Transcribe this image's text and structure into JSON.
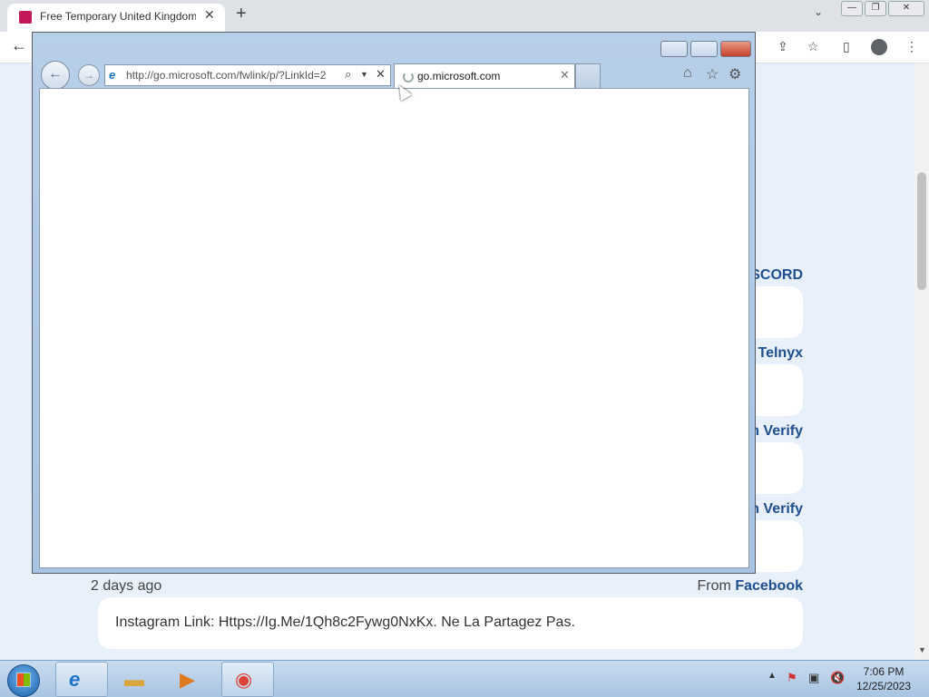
{
  "chrome": {
    "tab_title": "Free Temporary United Kingdom",
    "new_tab_symbol": "+"
  },
  "page": {
    "sources": [
      {
        "label": "SCORD"
      },
      {
        "label": "Telnyx"
      },
      {
        "label": "n Verify"
      },
      {
        "label": "n Verify"
      }
    ],
    "last_message": {
      "time_ago": "2 days ago",
      "from_prefix": "From",
      "from_source": "Facebook",
      "text": "Instagram Link: Https://Ig.Me/1Qh8c2Fywg0NxKx. Ne La Partagez Pas."
    }
  },
  "ie": {
    "address": "http://go.microsoft.com/fwlink/p/?LinkId=2",
    "tab_title": "go.microsoft.com"
  },
  "taskbar": {
    "time": "7:06 PM",
    "date": "12/25/2023"
  }
}
